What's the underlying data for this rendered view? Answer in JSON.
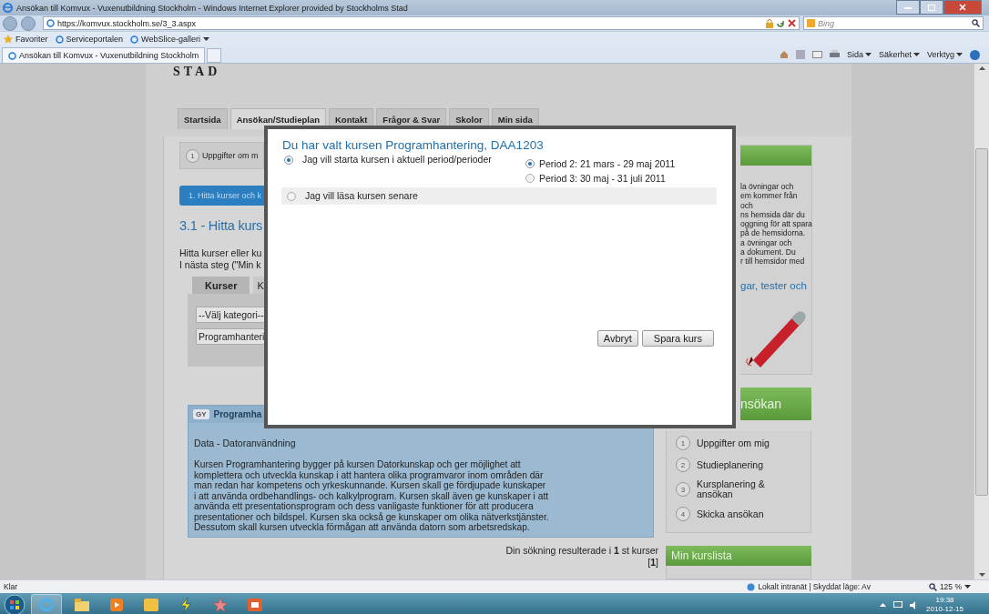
{
  "window": {
    "title": "Ansökan till Komvux - Vuxenutbildning Stockholm - Windows Internet Explorer provided by Stockholms Stad"
  },
  "address_bar": {
    "url": "https://komvux.stockholm.se/3_3.aspx",
    "search_placeholder": "Bing"
  },
  "favorites_bar": {
    "items": [
      "Favoriter",
      "Serviceportalen",
      "WebSlice-galleri"
    ]
  },
  "browser_tabs": [
    {
      "label": "Ansökan till Komvux - Vuxenutbildning Stockholm",
      "selected": true
    }
  ],
  "command_bar": [
    "Sida",
    "Säkerhet",
    "Verktyg"
  ],
  "page": {
    "logo": "STAD",
    "nav_tabs": [
      {
        "label": "Startsida",
        "selected": false
      },
      {
        "label": "Ansökan/Studieplan",
        "selected": true
      },
      {
        "label": "Kontakt",
        "selected": false
      },
      {
        "label": "Frågor & Svar",
        "selected": false
      },
      {
        "label": "Skolor",
        "selected": false
      },
      {
        "label": "Min sida",
        "selected": false
      }
    ],
    "step_box": {
      "number": "1",
      "label": "Uppgifter om m"
    },
    "step_bar": "1. Hitta kurser och k",
    "heading": "3.1 - Hitta kurs",
    "intro_lines": [
      "Hitta kurser eller ku",
      "I nästa steg (\"Min k"
    ],
    "search_tabs": [
      {
        "label": "Kurser",
        "selected": true
      },
      {
        "label": "K",
        "selected": false
      }
    ],
    "category_select": "--Välj kategori--",
    "search_field": "Programhanteri",
    "course": {
      "level": "GY",
      "title": "Programha",
      "category": "Data - Datoranvändning",
      "description": "Kursen Programhantering bygger på kursen Datorkunskap och ger möjlighet att komplettera och utveckla kunskap i att hantera olika programvaror inom områden där man redan har kompetens och yrkeskunnande. Kursen skall ge fördjupade kunskaper i att använda ordbehandlings- och kalkylprogram. Kursen skall även ge kunskaper i att använda ett presentationsprogram och dess vanligaste funktioner för att producera presentationer och bildspel. Kursen ska också ge kunskaper om olika nätverkstjänster. Dessutom skall kursen utveckla förmågan att använda datorn som arbetsredskap."
    },
    "results": {
      "text": "Din sökning resulterade i **1** st kurser",
      "pages": "[**1**]"
    },
    "sidebar": {
      "info_lines": [
        "la övningar och",
        "em kommer från",
        "och",
        "ns hemsida där du",
        "oggning för att spara",
        "på de hemsidorna.",
        "a övningar och",
        "a dokument. Du",
        "r till hemsidor med"
      ],
      "info_link": "gar, tester och",
      "steps_title": "nsökan",
      "steps": [
        {
          "number": "1",
          "label": "Uppgifter om mig"
        },
        {
          "number": "2",
          "label": "Studieplanering"
        },
        {
          "number": "3",
          "label": "Kursplanering & ansökan"
        },
        {
          "number": "4",
          "label": "Skicka ansökan"
        }
      ],
      "list_title": "Min kurslista"
    }
  },
  "dialog": {
    "title": "Du har valt kursen Programhantering, DAA1203",
    "options": [
      {
        "label": "Jag vill starta kursen i aktuell period/perioder",
        "selected": true,
        "periods": [
          {
            "label": "Period 2: 21 mars - 29 maj 2011",
            "selected": true
          },
          {
            "label": "Period 3: 30 maj - 31 juli 2011",
            "selected": false
          }
        ]
      },
      {
        "label": "Jag vill läsa kursen senare",
        "selected": false
      }
    ],
    "buttons": [
      "Avbryt",
      "Spara kurs"
    ]
  },
  "status_bar": {
    "text": "Klar",
    "zone": "Lokalt intranät | Skyddat läge: Av",
    "zoom": "125 %"
  },
  "taskbar": {
    "time": "19:38",
    "date": "2010-12-15"
  }
}
